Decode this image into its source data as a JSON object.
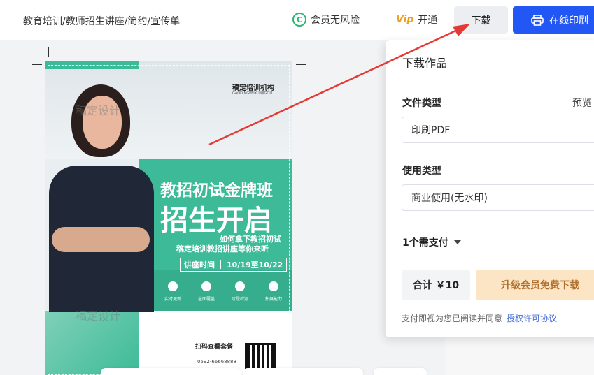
{
  "header": {
    "breadcrumb": "教育培训/教师招生讲座/简约/宣传单",
    "member_risk_icon": "C",
    "member_risk_label": "会员无风险",
    "vip_icon": "Vip",
    "open_vip_label": "开通",
    "download_label": "下载",
    "print_label": "在线印刷"
  },
  "poster": {
    "org_name": "稿定培训机构",
    "org_sub": "GAODINGPEIXUNJIGOU",
    "title_line1": "教招初试金牌班",
    "title_line2": "招生开启",
    "subtitle_line1": "如何拿下教招初试",
    "subtitle_line2": "稿定培训教招讲座等你来听",
    "lecture_time_label": "讲座时间",
    "lecture_time_value": "10/19至10/22",
    "features": [
      "实时更新",
      "全面覆盖",
      "阶段检测",
      "拓展能力"
    ],
    "watermark": "稿定设计",
    "scan_text": "扫码查看套餐",
    "phone": "0592-66668888"
  },
  "download_panel": {
    "title": "下载作品",
    "file_type_label": "文件类型",
    "preview_label": "预览",
    "file_type_value": "印刷PDF",
    "usage_type_label": "使用类型",
    "usage_type_value": "商业使用(无水印)",
    "pay_count": "1个需支付",
    "total": "合计 ￥10",
    "upgrade_button": "升级会员免费下载",
    "agree_text": "支付即视为您已阅读并同意",
    "license_link": "授权许可协议"
  },
  "colors": {
    "accent_blue": "#2357f5",
    "teal": "#3dbb98",
    "annotation_red": "#e53935",
    "upgrade_gold": "#fbe5c4"
  }
}
